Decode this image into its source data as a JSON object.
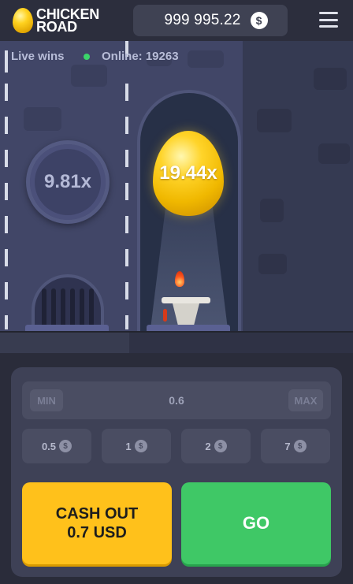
{
  "header": {
    "logo_line1": "CHICKEN",
    "logo_line2": "ROAD",
    "balance": "999 995.22",
    "currency_icon": "$"
  },
  "scene": {
    "live_wins_label": "Live wins",
    "online_label": "Online: 19263",
    "lane_multiplier": "9.81x",
    "egg_multiplier": "19.44x"
  },
  "controls": {
    "min_label": "MIN",
    "max_label": "MAX",
    "bet_value": "0.6",
    "chips": [
      "0.5",
      "1",
      "2",
      "7"
    ],
    "chip_currency_icon": "$",
    "cashout_line1": "CASH OUT",
    "cashout_line2": "0.7 USD",
    "go_label": "GO"
  },
  "colors": {
    "accent_yellow": "#ffc11b",
    "accent_green": "#3fc866",
    "scene_bg": "#414667"
  }
}
